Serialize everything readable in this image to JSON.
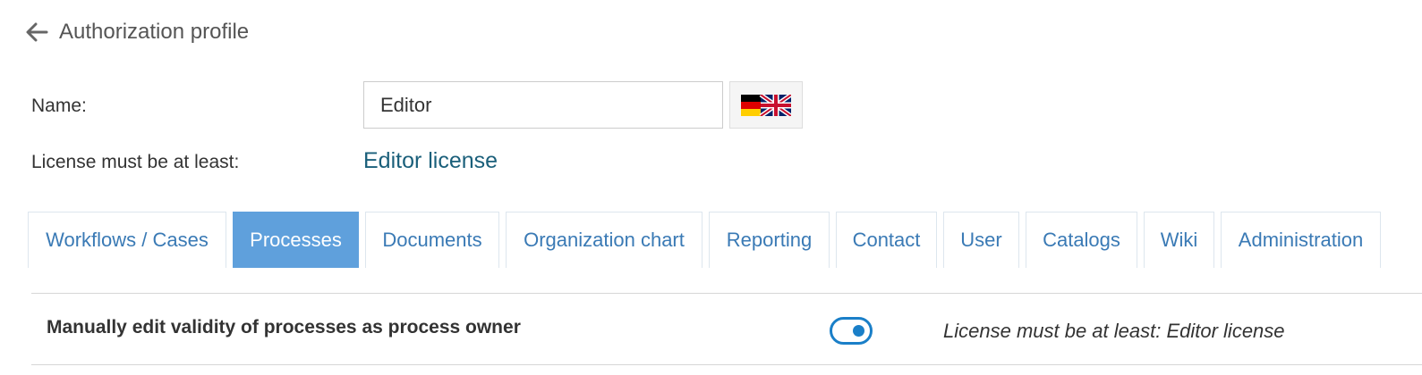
{
  "header": {
    "back_icon": "arrow-left-icon",
    "title": "Authorization profile"
  },
  "form": {
    "name_label": "Name:",
    "name_value": "Editor",
    "language_button_icons": [
      "german-flag-icon",
      "uk-flag-icon"
    ],
    "license_label": "License must be at least:",
    "license_link": "Editor license"
  },
  "tabs": [
    {
      "label": "Workflows / Cases",
      "active": false
    },
    {
      "label": "Processes",
      "active": true
    },
    {
      "label": "Documents",
      "active": false
    },
    {
      "label": "Organization chart",
      "active": false
    },
    {
      "label": "Reporting",
      "active": false
    },
    {
      "label": "Contact",
      "active": false
    },
    {
      "label": "User",
      "active": false
    },
    {
      "label": "Catalogs",
      "active": false
    },
    {
      "label": "Wiki",
      "active": false
    },
    {
      "label": "Administration",
      "active": false
    }
  ],
  "permissions": [
    {
      "label": "Manually edit validity of processes as process owner",
      "enabled": true,
      "note": "License must be at least: Editor license"
    }
  ],
  "colors": {
    "accent": "#5fa0dc",
    "link": "#1a5f7a",
    "toggle": "#1a7fc8",
    "tab_text": "#3a7ab5"
  }
}
